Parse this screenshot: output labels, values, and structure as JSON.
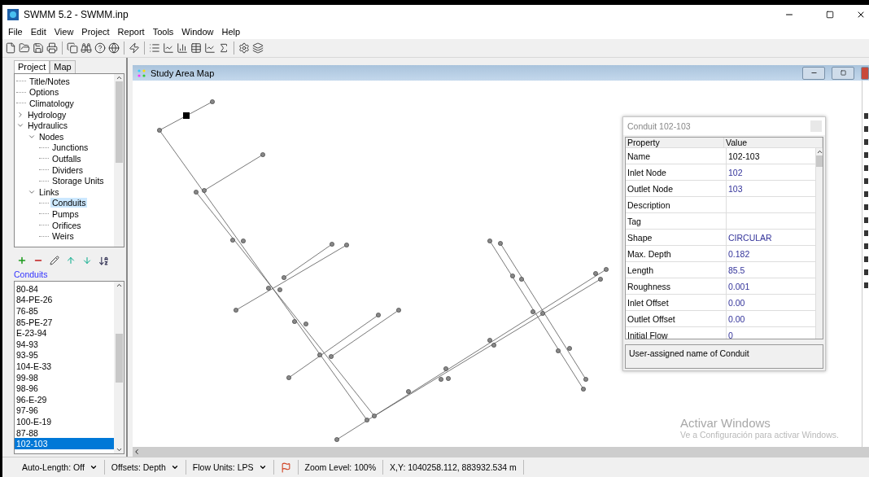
{
  "window": {
    "title": "SWMM 5.2 - SWMM.inp"
  },
  "menu": [
    "File",
    "Edit",
    "View",
    "Project",
    "Report",
    "Tools",
    "Window",
    "Help"
  ],
  "browser": {
    "tabs": [
      {
        "label": "Project",
        "selected": true
      },
      {
        "label": "Map",
        "selected": false
      }
    ],
    "tree": [
      {
        "label": "Title/Notes",
        "selected": false
      },
      {
        "label": "Options",
        "selected": false
      },
      {
        "label": "Climatology",
        "selected": false
      },
      {
        "label": "Hydrology",
        "selected": false,
        "expanded": false
      },
      {
        "label": "Hydraulics",
        "selected": false,
        "expanded": true,
        "children": [
          {
            "label": "Nodes",
            "selected": false,
            "expanded": true,
            "children": [
              {
                "label": "Junctions",
                "selected": false
              },
              {
                "label": "Outfalls",
                "selected": false
              },
              {
                "label": "Dividers",
                "selected": false
              },
              {
                "label": "Storage Units",
                "selected": false
              }
            ]
          },
          {
            "label": "Links",
            "selected": false,
            "expanded": true,
            "children": [
              {
                "label": "Conduits",
                "selected": true
              },
              {
                "label": "Pumps",
                "selected": false
              },
              {
                "label": "Orifices",
                "selected": false
              },
              {
                "label": "Weirs",
                "selected": false
              }
            ]
          }
        ]
      }
    ],
    "list_title": "Conduits",
    "items": [
      {
        "label": "80-84",
        "selected": false
      },
      {
        "label": "84-PE-26",
        "selected": false
      },
      {
        "label": "76-85",
        "selected": false
      },
      {
        "label": "85-PE-27",
        "selected": false
      },
      {
        "label": "E-23-94",
        "selected": false
      },
      {
        "label": "94-93",
        "selected": false
      },
      {
        "label": "93-95",
        "selected": false
      },
      {
        "label": "104-E-33",
        "selected": false
      },
      {
        "label": "99-98",
        "selected": false
      },
      {
        "label": "98-96",
        "selected": false
      },
      {
        "label": "96-E-29",
        "selected": false
      },
      {
        "label": "97-96",
        "selected": false
      },
      {
        "label": "100-E-19",
        "selected": false
      },
      {
        "label": "87-88",
        "selected": false
      },
      {
        "label": "102-103",
        "selected": true
      }
    ]
  },
  "map_window": {
    "title": "Study Area Map"
  },
  "property_dialog": {
    "title": "Conduit 102-103",
    "columns": [
      "Property",
      "Value"
    ],
    "rows": [
      {
        "property": "Name",
        "value": "102-103"
      },
      {
        "property": "Inlet Node",
        "value": "102"
      },
      {
        "property": "Outlet Node",
        "value": "103"
      },
      {
        "property": "Description",
        "value": ""
      },
      {
        "property": "Tag",
        "value": ""
      },
      {
        "property": "Shape",
        "value": "CIRCULAR"
      },
      {
        "property": "Max. Depth",
        "value": "0.182"
      },
      {
        "property": "Length",
        "value": "85.5"
      },
      {
        "property": "Roughness",
        "value": "0.001"
      },
      {
        "property": "Inlet Offset",
        "value": "0.00"
      },
      {
        "property": "Outlet Offset",
        "value": "0.00"
      },
      {
        "property": "Initial Flow",
        "value": "0"
      }
    ],
    "hint": "User-assigned name of Conduit"
  },
  "activation_notice": {
    "title": "Activar Windows",
    "subtitle": "Ve a Configuración para activar Windows."
  },
  "status_bar": [
    {
      "kind": "dropdown",
      "text": "Auto-Length: Off"
    },
    {
      "kind": "dropdown",
      "text": "Offsets: Depth"
    },
    {
      "kind": "dropdown",
      "text": "Flow Units: LPS"
    },
    {
      "kind": "icon"
    },
    {
      "kind": "text",
      "text": "Zoom Level: 100%"
    },
    {
      "kind": "text",
      "text": "X,Y: 1040258.112, 883932.534 m"
    }
  ]
}
